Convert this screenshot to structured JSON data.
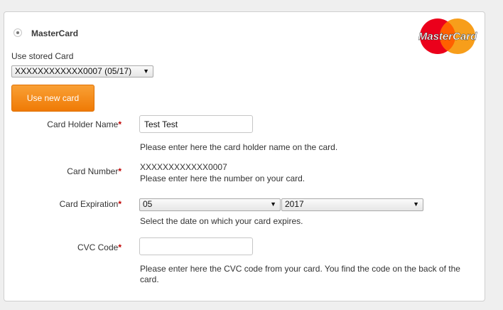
{
  "payment_method": {
    "label": "MasterCard"
  },
  "logo": {
    "text": "MasterCard",
    "red": "#eb001b",
    "orange": "#f79e1b"
  },
  "stored_card": {
    "label": "Use stored Card",
    "selected": "XXXXXXXXXXXX0007 (05/17)"
  },
  "new_card_button": {
    "label": "Use new card"
  },
  "holder": {
    "label": "Card Holder Name",
    "required_mark": "*",
    "value": "Test Test",
    "help": "Please enter here the card holder name on the card."
  },
  "number": {
    "label": "Card Number",
    "required_mark": "*",
    "masked_value": "XXXXXXXXXXXX0007",
    "help": "Please enter here the number on your card."
  },
  "expiration": {
    "label": "Card Expiration",
    "required_mark": "*",
    "month": "05",
    "year": "2017",
    "help": "Select the date on which your card expires."
  },
  "cvc": {
    "label": "CVC Code",
    "required_mark": "*",
    "value": "",
    "help": "Please enter here the CVC code from your card. You find the code on the back of the card."
  },
  "colors": {
    "accent": "#f28a1c",
    "required": "#c00000"
  }
}
